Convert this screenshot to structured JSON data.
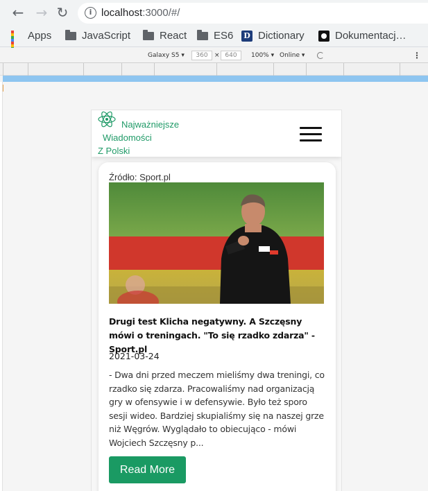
{
  "browser": {
    "url_host": "localhost",
    "url_rest": ":3000/#/",
    "nav": {
      "back_icon": "←",
      "forward_icon": "→",
      "reload_icon": "↻"
    },
    "bookmarks": [
      {
        "label": "Apps",
        "icon": "apps-grid-icon"
      },
      {
        "label": "JavaScript",
        "icon": "folder-icon"
      },
      {
        "label": "React",
        "icon": "folder-icon"
      },
      {
        "label": "ES6",
        "icon": "folder-icon"
      },
      {
        "label": "Dictionary",
        "icon": "dictionary-icon"
      },
      {
        "label": "Dokumentacj…",
        "icon": "github-icon"
      }
    ]
  },
  "devtools": {
    "device": "Galaxy S5 ▾",
    "width": "360",
    "times": "×",
    "height": "640",
    "zoom": "100% ▾",
    "network": "Online ▾",
    "menu": "⋮"
  },
  "app": {
    "brand_line1": "Najważniejsze",
    "brand_line2": "Wiadomości",
    "brand_line3": "Z Polski",
    "brand_color": "#1f9a67"
  },
  "article": {
    "source": "Źródło: Sport.pl",
    "headline": "Drugi test Klicha negatywny. A Szczęsny mówi o treningach. \"To się rzadko zdarza\" - Sport.pl",
    "date": "2021-03-24",
    "excerpt": "- Dwa dni przed meczem mieliśmy dwa treningi, co rzadko się zdarza. Pracowaliśmy nad organizacją gry w ofensywie i w defensywie. Było też sporo sesji wideo. Bardziej skupialiśmy się na naszej grze niż Węgrów. Wyglądało to obiecująco - mówi Wojciech Szczęsny p...",
    "read_more": "Read More",
    "button_color": "#1a9a63"
  }
}
